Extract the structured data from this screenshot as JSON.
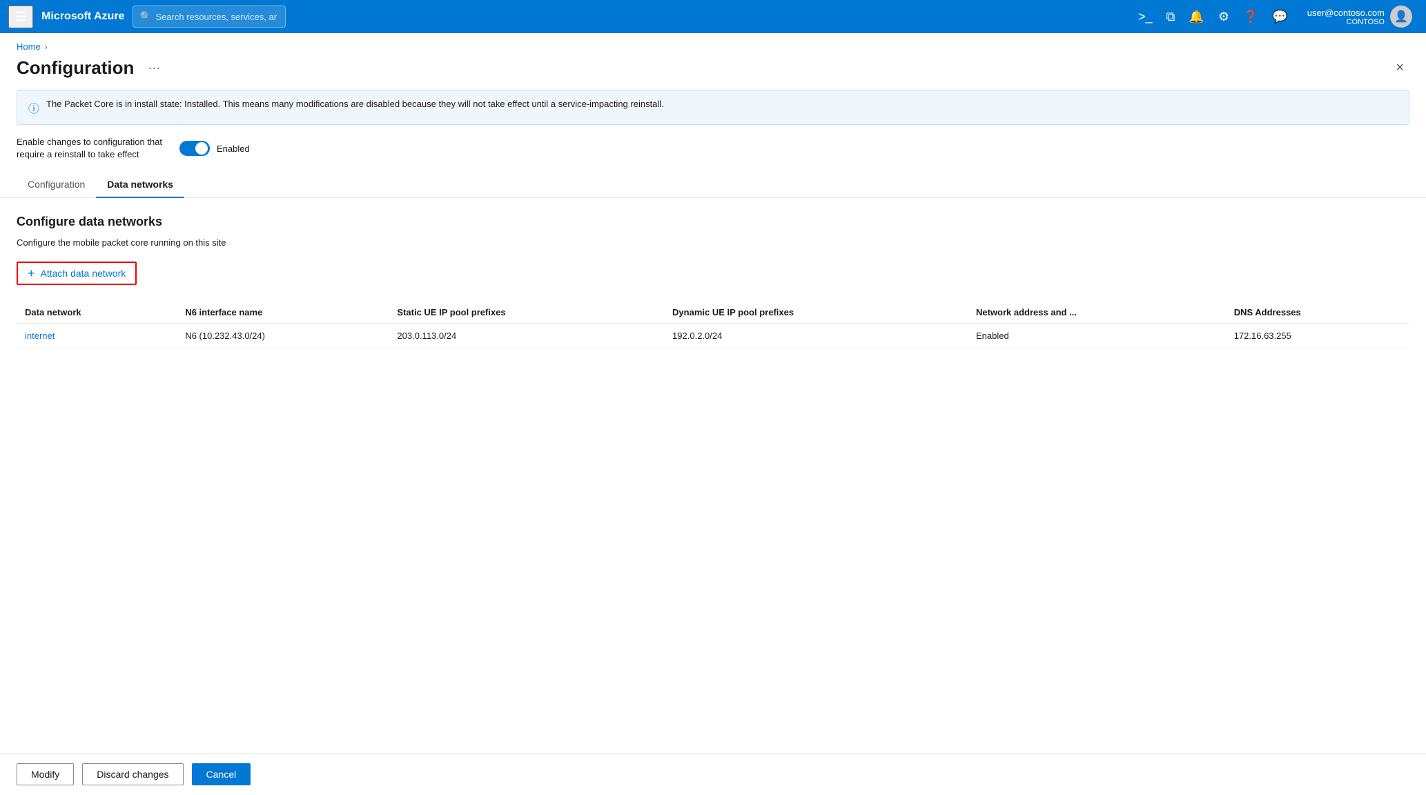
{
  "topnav": {
    "brand": "Microsoft Azure",
    "search_placeholder": "Search resources, services, and docs (G+/)",
    "user_email": "user@contoso.com",
    "user_org": "CONTOSO"
  },
  "breadcrumb": {
    "home_label": "Home"
  },
  "page": {
    "title": "Configuration",
    "close_label": "×",
    "more_label": "···"
  },
  "info_banner": {
    "text": "The Packet Core is in install state: Installed. This means many modifications are disabled because they will not take effect until a service-impacting reinstall."
  },
  "toggle": {
    "label": "Enable changes to configuration that require a reinstall to take effect",
    "state_label": "Enabled"
  },
  "tabs": [
    {
      "label": "Configuration",
      "active": false
    },
    {
      "label": "Data networks",
      "active": true
    }
  ],
  "section": {
    "title": "Configure data networks",
    "description": "Configure the mobile packet core running on this site"
  },
  "attach_button": {
    "label": "Attach data network",
    "plus": "+"
  },
  "table": {
    "headers": [
      "Data network",
      "N6 interface name",
      "Static UE IP pool prefixes",
      "Dynamic UE IP pool prefixes",
      "Network address and ...",
      "DNS Addresses"
    ],
    "rows": [
      {
        "data_network": "internet",
        "n6_interface": "N6 (10.232.43.0/24)",
        "static_ue_ip": "203.0.113.0/24",
        "dynamic_ue_ip": "192.0.2.0/24",
        "network_address": "Enabled",
        "dns_addresses": "172.16.63.255"
      }
    ]
  },
  "footer": {
    "modify_label": "Modify",
    "discard_label": "Discard changes",
    "cancel_label": "Cancel"
  }
}
